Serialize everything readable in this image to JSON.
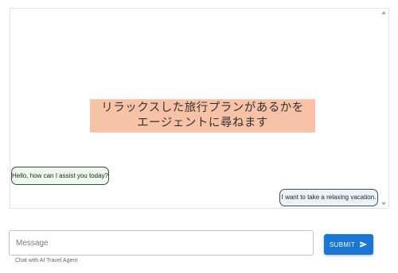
{
  "chat": {
    "banner_line1": "リラックスした旅行プランがあるかを",
    "banner_line2": "エージェントに尋ねます",
    "messages": [
      {
        "role": "agent",
        "text": "Hello, how can I assist you today?"
      },
      {
        "role": "user",
        "text": "I want to take a relaxing vacation."
      }
    ]
  },
  "composer": {
    "placeholder": "Message",
    "value": "",
    "helper_text": "Chat with AI Travel Agent",
    "submit_label": "SUBMIT"
  },
  "colors": {
    "banner_bg": "#f8c2a6",
    "agent_bubble_bg": "#eef9ee",
    "user_bubble_bg": "#ecf4fa",
    "primary": "#1976d2"
  },
  "icons": {
    "submit": "send-icon"
  }
}
